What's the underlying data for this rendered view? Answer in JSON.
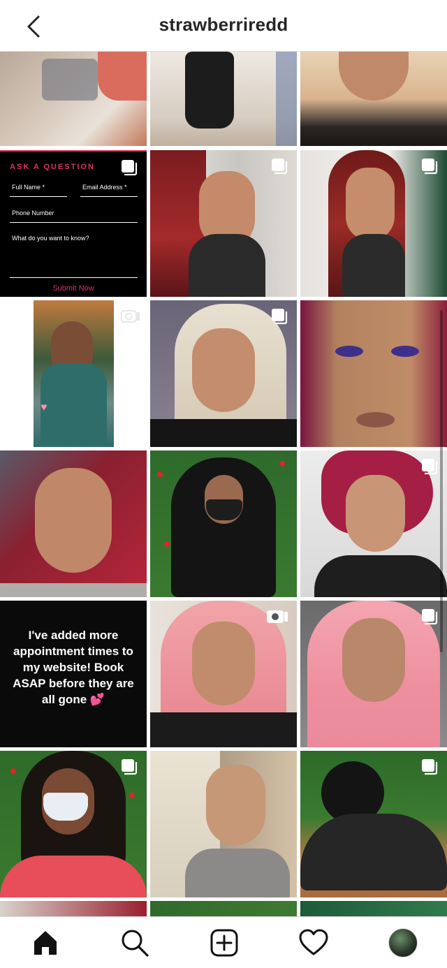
{
  "header": {
    "username": "strawberriredd"
  },
  "form_post": {
    "title": "ASK A QUESTION",
    "full_name": "Full Name *",
    "email": "Email Address *",
    "phone": "Phone Number",
    "question": "What do you want to know?",
    "submit": "Submit Now"
  },
  "text_post": {
    "line1": "I've added more",
    "line2": "appointment times to",
    "line3": "my website! Book",
    "line4": "ASAP before they are",
    "line5": "all gone"
  },
  "icons": {
    "back": "chevron-left-icon",
    "carousel": "carousel-icon",
    "video": "video-camera-icon",
    "tabs": [
      "home-icon",
      "search-icon",
      "new-post-icon",
      "heart-icon",
      "profile-avatar"
    ]
  },
  "colors": {
    "accent": "#e0315f"
  }
}
